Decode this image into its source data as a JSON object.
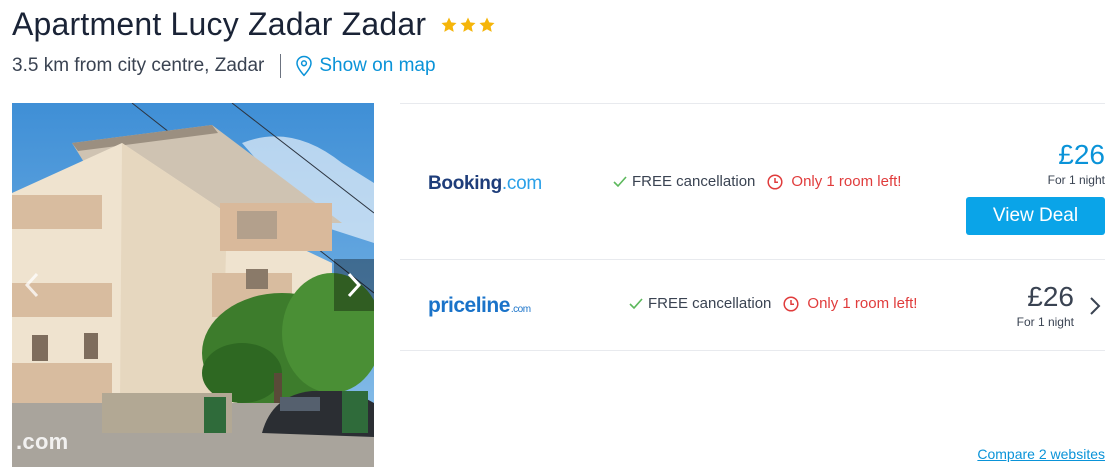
{
  "hotel": {
    "name": "Apartment Lucy Zadar Zadar",
    "stars": 3,
    "distance": "3.5 km from city centre, Zadar",
    "map_link": "Show on map"
  },
  "photo": {
    "watermark": ".com"
  },
  "deals": [
    {
      "provider": "Booking",
      "provider_suffix": ".com",
      "free_cancellation": "FREE cancellation",
      "availability": "Only 1 room left!",
      "price": "£26",
      "per": "For 1 night",
      "cta": "View Deal"
    },
    {
      "provider": "priceline",
      "provider_suffix": ".com",
      "free_cancellation": "FREE cancellation",
      "availability": "Only 1 room left!",
      "price": "£26",
      "per": "For 1 night"
    }
  ],
  "compare_link": "Compare 2 websites",
  "colors": {
    "accent": "#0a93d8",
    "button": "#0aa4e8",
    "star": "#f5b50a",
    "warning": "#e03c3c",
    "check": "#5cb85c"
  },
  "icons": [
    "star-icon",
    "map-pin-icon",
    "chevron-left-icon",
    "chevron-right-icon",
    "check-icon",
    "clock-icon"
  ]
}
